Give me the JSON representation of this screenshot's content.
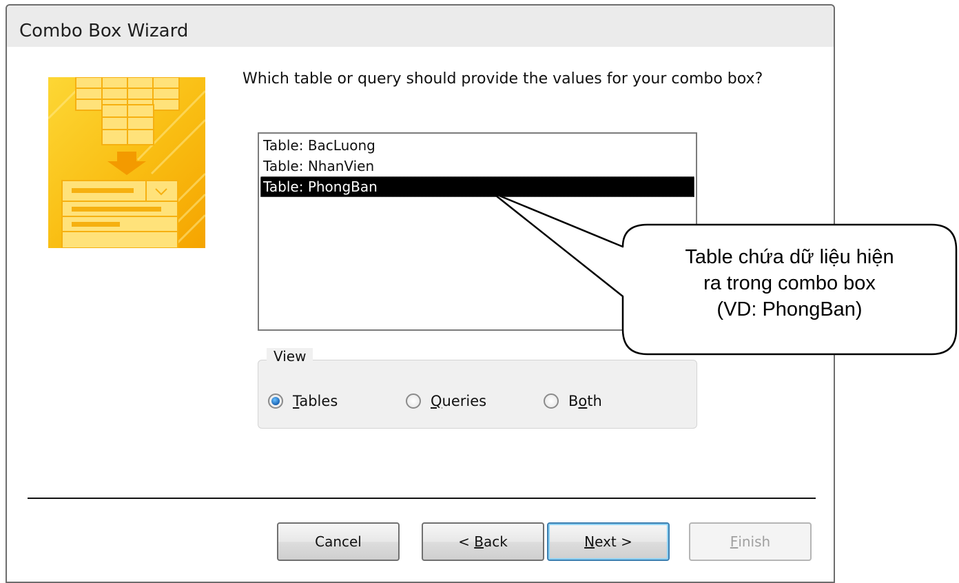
{
  "window": {
    "title": "Combo Box Wizard"
  },
  "question": "Which table or query should provide the values for your combo box?",
  "list": {
    "items": [
      {
        "label": "Table: BacLuong",
        "selected": false
      },
      {
        "label": "Table: NhanVien",
        "selected": false
      },
      {
        "label": "Table: PhongBan",
        "selected": true
      }
    ]
  },
  "view_group": {
    "legend": "View",
    "options": [
      {
        "pre": "",
        "accel": "T",
        "post": "ables",
        "checked": true
      },
      {
        "pre": "",
        "accel": "Q",
        "post": "ueries",
        "checked": false
      },
      {
        "pre": "B",
        "accel": "o",
        "post": "th",
        "checked": false
      }
    ]
  },
  "buttons": {
    "cancel": {
      "pre": "Cancel",
      "accel": "",
      "post": ""
    },
    "back": {
      "pre": "< ",
      "accel": "B",
      "post": "ack"
    },
    "next": {
      "pre": "",
      "accel": "N",
      "post": "ext >"
    },
    "finish": {
      "pre": "",
      "accel": "F",
      "post": "inish"
    }
  },
  "callout": {
    "lines": [
      "Table chứa dữ liệu hiện",
      "ra trong combo box",
      "(VD: PhongBan)"
    ]
  },
  "colors": {
    "selection": "#000000",
    "art_yellow": "#f9bd12",
    "default_button_border": "#3c7fb1"
  }
}
